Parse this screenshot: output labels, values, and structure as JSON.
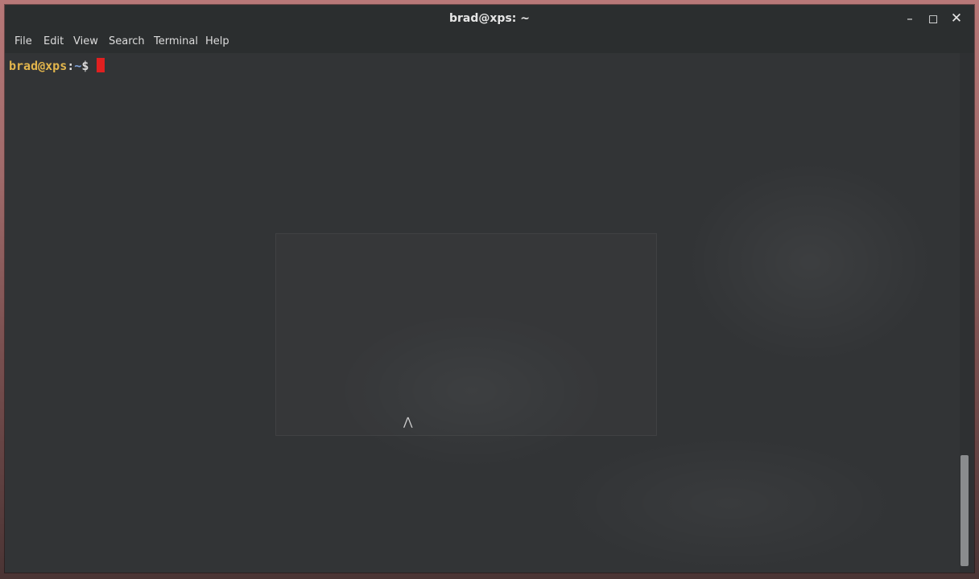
{
  "window": {
    "title": "brad@xps: ~",
    "controls": {
      "minimize_icon": "minimize-icon",
      "maximize_icon": "maximize-icon",
      "close_icon": "close-icon"
    }
  },
  "menubar": {
    "items": [
      {
        "label": "File"
      },
      {
        "label": "Edit"
      },
      {
        "label": "View"
      },
      {
        "label": "Search"
      },
      {
        "label": "Terminal"
      },
      {
        "label": "Help"
      }
    ]
  },
  "terminal": {
    "prompt": {
      "user_host": "brad@xps",
      "separator": ":",
      "path": "~",
      "symbol": "$"
    },
    "cursor_color": "#e02020"
  },
  "colors": {
    "prompt_user": "#e2b54c",
    "prompt_path": "#7ea1d8",
    "background": "#323436"
  }
}
